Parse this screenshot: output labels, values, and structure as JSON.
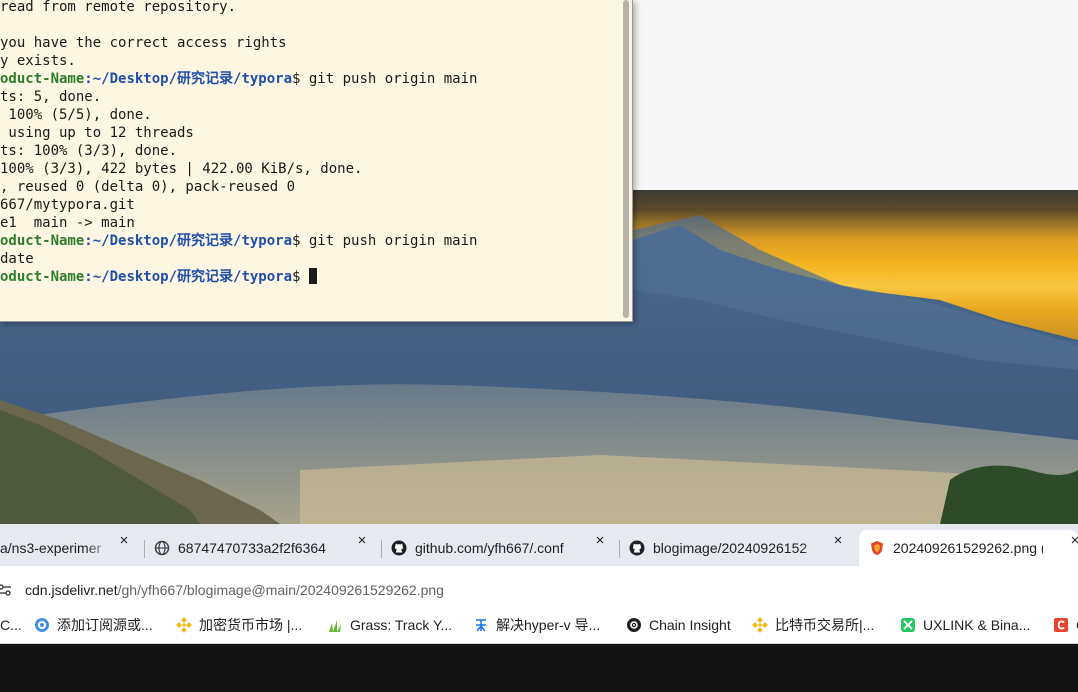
{
  "terminal": {
    "lines": [
      {
        "text": "read from remote repository."
      },
      {
        "text": ""
      },
      {
        "text": "you have the correct access rights"
      },
      {
        "text": "y exists."
      },
      {
        "user": "oduct-Name",
        "path": ":~/Desktop/研究记录/typora",
        "cmd": "$ git push origin main"
      },
      {
        "text": "ts: 5, done."
      },
      {
        "text": " 100% (5/5), done."
      },
      {
        "text": " using up to 12 threads"
      },
      {
        "text": "ts: 100% (3/3), done."
      },
      {
        "text": "100% (3/3), 422 bytes | 422.00 KiB/s, done."
      },
      {
        "text": ", reused 0 (delta 0), pack-reused 0"
      },
      {
        "text": "667/mytypora.git"
      },
      {
        "text": "e1  main -> main"
      },
      {
        "user": "oduct-Name",
        "path": ":~/Desktop/研究记录/typora",
        "cmd": "$ git push origin main"
      },
      {
        "text": "date"
      },
      {
        "user": "oduct-Name",
        "path": ":~/Desktop/研究记录/typora",
        "cmd": "$ ",
        "cursor": true
      }
    ]
  },
  "tabs": [
    {
      "title": "a/ns3-experimer",
      "icon": "none",
      "close": "×"
    },
    {
      "title": "68747470733a2f2f6364",
      "icon": "globe-icon",
      "close": "×"
    },
    {
      "title": "github.com/yfh667/.conf",
      "icon": "github-icon",
      "close": "×"
    },
    {
      "title": "blogimage/20240926152",
      "icon": "github-icon",
      "close": "×"
    },
    {
      "title": "202409261529262.png (",
      "icon": "shield-icon",
      "close": "×",
      "active": true
    }
  ],
  "address": {
    "host": "cdn.jsdelivr.net",
    "path": "/gh/yfh667/blogimage@main/202409261529262.png"
  },
  "bookmarks": [
    {
      "label": "C...",
      "icon": "none"
    },
    {
      "label": "添加订阅源或...",
      "icon": "rss-icon"
    },
    {
      "label": "加密货币市场 |...",
      "icon": "binance-icon"
    },
    {
      "label": "Grass: Track Y...",
      "icon": "grass-icon"
    },
    {
      "label": "解决hyper-v 导...",
      "icon": "zhihu-icon"
    },
    {
      "label": "Chain Insight",
      "icon": "chain-insight-icon"
    },
    {
      "label": "比特币交易所|...",
      "icon": "binance-icon"
    },
    {
      "label": "UXLINK & Bina...",
      "icon": "uxlink-icon"
    },
    {
      "label": "C",
      "icon": "c-icon"
    }
  ],
  "colors": {
    "terminal_bg": "#fdf6e3",
    "prompt_user": "#2d7d2d",
    "prompt_path": "#1f4fa8",
    "tabbar_bg": "#e6e9ef",
    "active_tab_bg": "#ffffff"
  }
}
